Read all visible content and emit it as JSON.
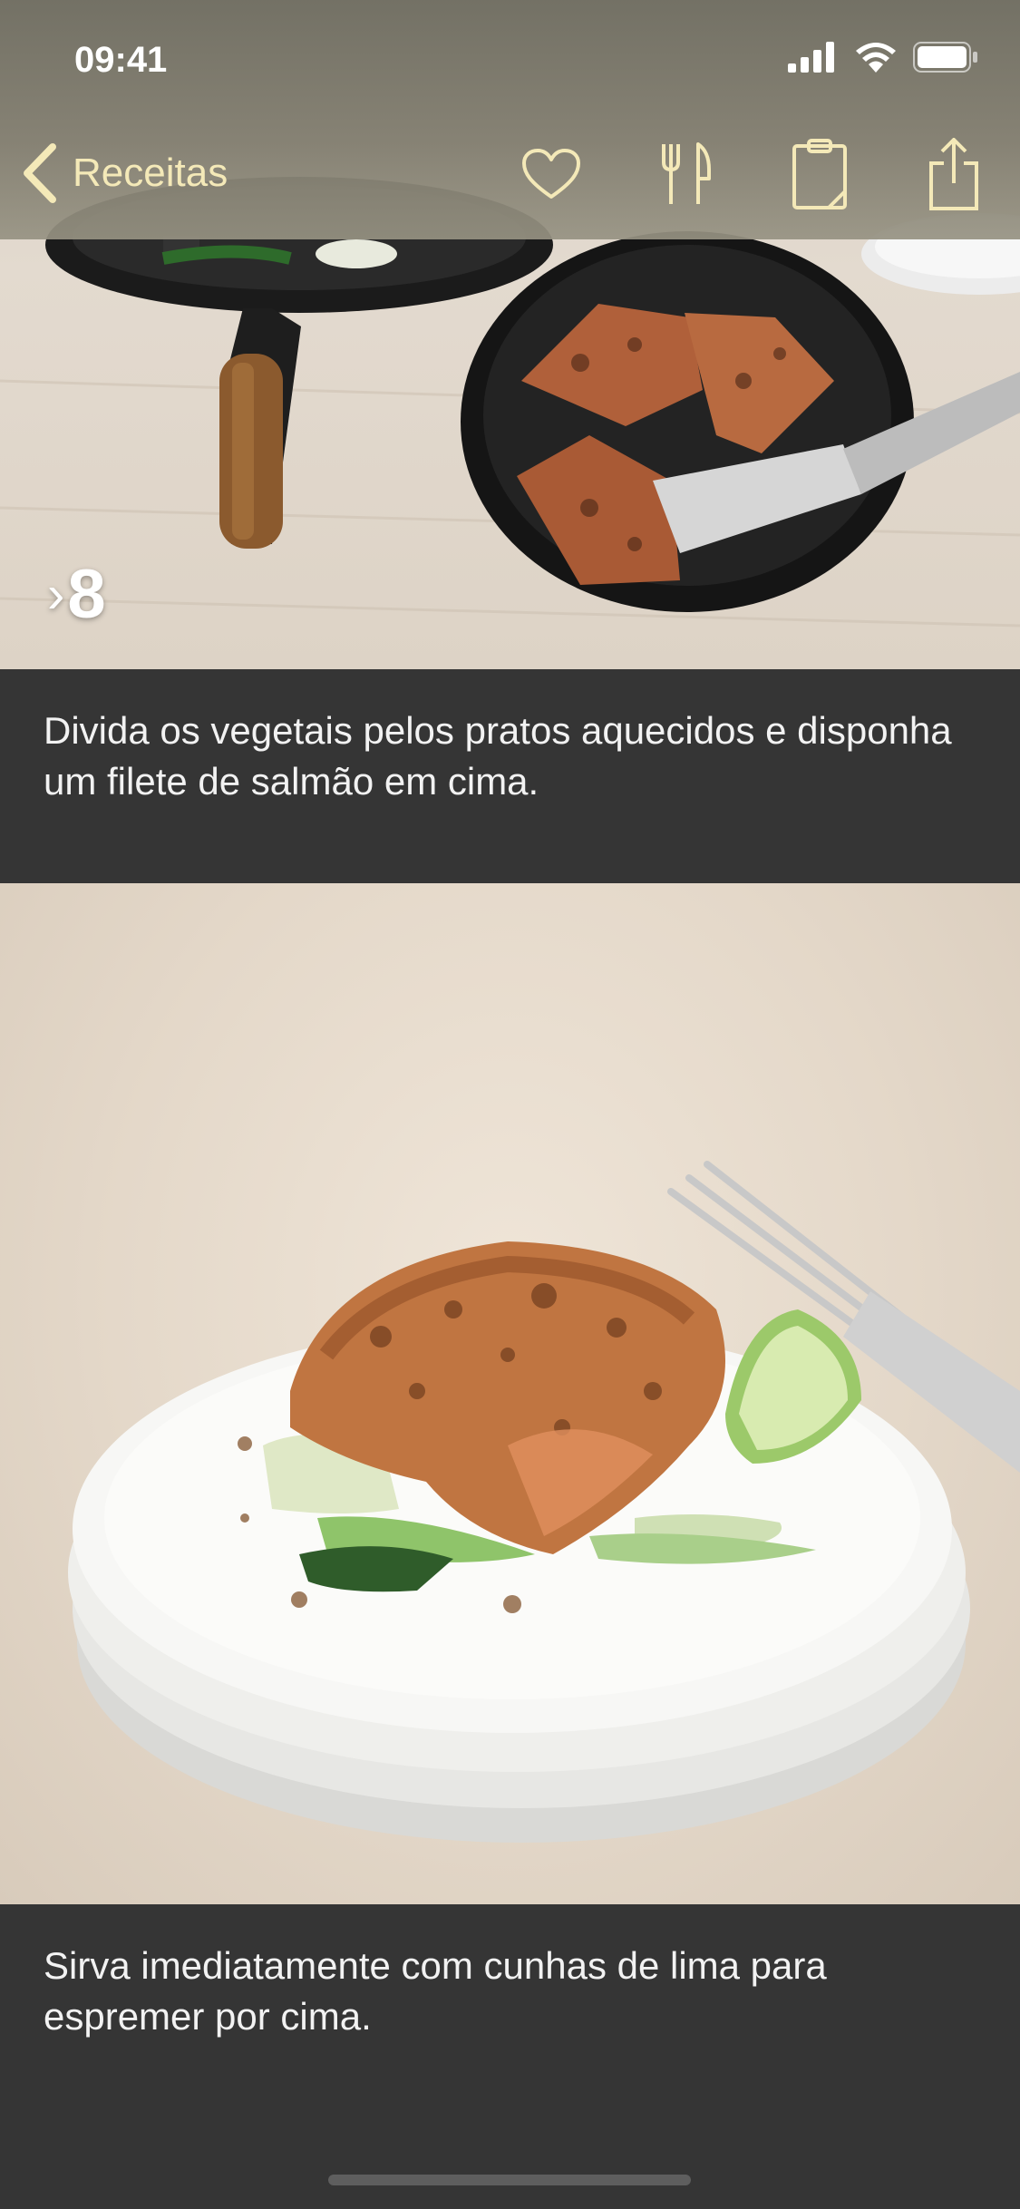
{
  "status_bar": {
    "time": "09:41"
  },
  "nav": {
    "back_label": "Receitas",
    "icons": [
      "heart-icon",
      "utensils-icon",
      "clipboard-icon",
      "share-icon"
    ]
  },
  "steps": [
    {
      "number": "8",
      "text": "Divida os vegetais pelos pratos aquecidos e disponha um filete de salmão em cima."
    },
    {
      "text": "Sirva imediatamente com cunhas de lima para espremer por cima."
    }
  ],
  "colors": {
    "accent": "#f4e9b8",
    "background": "#353535"
  }
}
